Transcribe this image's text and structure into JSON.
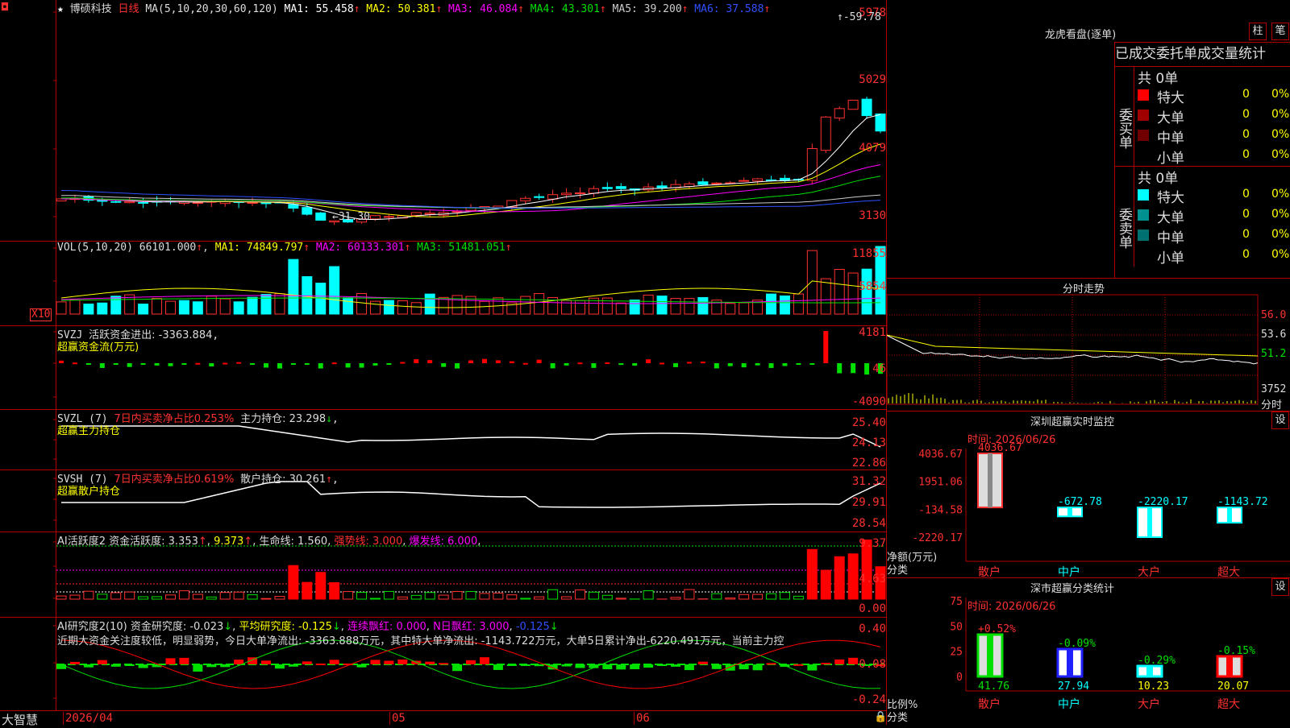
{
  "main": {
    "stock": "博硕科技",
    "period": "日线",
    "ma_params": "MA(5,10,20,30,60,120)",
    "ma": [
      {
        "label": "MA1: 55.458",
        "color": "#ffffff"
      },
      {
        "label": "MA2: 50.381",
        "color": "#ffff00"
      },
      {
        "label": "MA3: 46.084",
        "color": "#ff00ff"
      },
      {
        "label": "MA4: 43.301",
        "color": "#00e000"
      },
      {
        "label": "MA5: 39.200",
        "color": "#cccccc"
      },
      {
        "label": "MA6: 37.588",
        "color": "#3050ff"
      }
    ],
    "yticks": [
      "5978",
      "5029",
      "4079",
      "3130"
    ],
    "high_label": "59.78",
    "low_label": "31.30"
  },
  "vol": {
    "title": "VOL(5,10,20)",
    "value": "66101.000",
    "ma": [
      {
        "label": "MA1: 74849.797",
        "color": "#ffff00"
      },
      {
        "label": "MA2: 60133.301",
        "color": "#ff00ff"
      },
      {
        "label": "MA3: 51481.051",
        "color": "#00e000"
      }
    ],
    "yticks": [
      "11855",
      "5854"
    ],
    "unit": "X10"
  },
  "svzj": {
    "title": "SVZJ",
    "active_label": "活跃资金进出: -3363.884",
    "sub": "超赢资金流(万元)",
    "yticks": [
      "4181",
      "46",
      "-4090"
    ]
  },
  "svzl": {
    "title": "SVZL (7)",
    "ratio": "7日内买卖净占比0.253%",
    "hold": "主力持仓: 23.298",
    "sub": "超赢主力持仓",
    "yticks": [
      "25.40",
      "24.13",
      "22.86"
    ]
  },
  "svsh": {
    "title": "SVSH (7)",
    "ratio": "7日内买卖净占比0.619%",
    "hold": "散户持仓: 30.261",
    "sub": "超赢散户持仓",
    "yticks": [
      "31.32",
      "29.91",
      "28.54"
    ]
  },
  "ai_active": {
    "title": "AI活跃度2",
    "fund": "资金活跃度: 3.353",
    "val2": "9.373",
    "life": "生命线: 1.560",
    "strong": "强势线: 3.000",
    "burst": "爆发线: 6.000",
    "yticks": [
      "9.37",
      "4.63",
      "0.00"
    ]
  },
  "ai_research": {
    "title": "AI研究度2(10)",
    "fund": "资金研究度: -0.023",
    "avg": "平均研究度: -0.125",
    "red": "连续飘红: 0.000",
    "nred": "N日飘红: 3.000",
    "last": "-0.125",
    "comment": "近期大资金关注度较低，明显弱势，今日大单净流出: -3363.888万元，其中特大单净流出: -1143.722万元，大单5日累计净出-6220.491万元，当前主力控",
    "yticks": [
      "0.40",
      "0.08",
      "-0.24"
    ]
  },
  "footer": {
    "brand": "大智慧",
    "dates": [
      "2026/04",
      "05",
      "06"
    ]
  },
  "lhb": {
    "title": "龙虎看盘(逐单)",
    "btn1": "柱",
    "btn2": "笔",
    "header": "已成交委托单成交量统计",
    "buy_side": "委买单",
    "sell_side": "委卖单",
    "buy_total": "共 0单",
    "sell_total": "共 0单",
    "buy_rows": [
      {
        "name": "特大",
        "count": "0",
        "pct": "0%",
        "color": "#ff0000"
      },
      {
        "name": "大单",
        "count": "0",
        "pct": "0%",
        "color": "#a00000"
      },
      {
        "name": "中单",
        "count": "0",
        "pct": "0%",
        "color": "#700000"
      },
      {
        "name": "小单",
        "count": "0",
        "pct": "0%",
        "color": ""
      }
    ],
    "sell_rows": [
      {
        "name": "特大",
        "count": "0",
        "pct": "0%",
        "color": "#00ffff"
      },
      {
        "name": "大单",
        "count": "0",
        "pct": "0%",
        "color": "#009090"
      },
      {
        "name": "中单",
        "count": "0",
        "pct": "0%",
        "color": "#007070"
      },
      {
        "name": "小单",
        "count": "0",
        "pct": "0%",
        "color": ""
      }
    ]
  },
  "fenshi": {
    "title": "分时走势",
    "prices": [
      "56.0",
      "53.6",
      "51.2"
    ],
    "vol": "3752",
    "unit": "分时"
  },
  "sz_monitor": {
    "title": "深圳超赢实时监控",
    "btn": "设",
    "time": "时间: 2026/06/26",
    "yticks": [
      "4036.67",
      "1951.06",
      "-134.58",
      "-2220.17"
    ],
    "ylabel": "净额(万元)",
    "xlabel": "分类",
    "bars": [
      {
        "cat": "散户",
        "value": 4036.67,
        "label": "4036.67",
        "catcolor": "#ff3030"
      },
      {
        "cat": "中户",
        "value": -672.78,
        "label": "-672.78",
        "catcolor": "#00ffff"
      },
      {
        "cat": "大户",
        "value": -2220.17,
        "label": "-2220.17",
        "catcolor": "#ff3030"
      },
      {
        "cat": "超大",
        "value": -1143.72,
        "label": "-1143.72",
        "catcolor": "#ff3030"
      }
    ]
  },
  "sz_class": {
    "title": "深市超赢分类统计",
    "btn": "设",
    "time": "时间: 2026/06/26",
    "yticks": [
      "75",
      "50",
      "25",
      "0"
    ],
    "ylabel": "比例%",
    "xlabel": "分类",
    "bars": [
      {
        "cat": "散户",
        "value": 41.76,
        "label": "41.76",
        "chg": "+0.52%",
        "chgcolor": "#ff3030",
        "catcolor": "#ff3030",
        "vcolor": "#00e000"
      },
      {
        "cat": "中户",
        "value": 27.94,
        "label": "27.94",
        "chg": "-0.09%",
        "chgcolor": "#00e000",
        "catcolor": "#00ffff",
        "vcolor": "#00ffff"
      },
      {
        "cat": "大户",
        "value": 10.23,
        "label": "10.23",
        "chg": "-0.29%",
        "chgcolor": "#00e000",
        "catcolor": "#ff3030",
        "vcolor": "#ffff00"
      },
      {
        "cat": "超大",
        "value": 20.07,
        "label": "20.07",
        "chg": "-0.15%",
        "chgcolor": "#00e000",
        "catcolor": "#ff3030",
        "vcolor": "#ffff00"
      }
    ]
  }
}
